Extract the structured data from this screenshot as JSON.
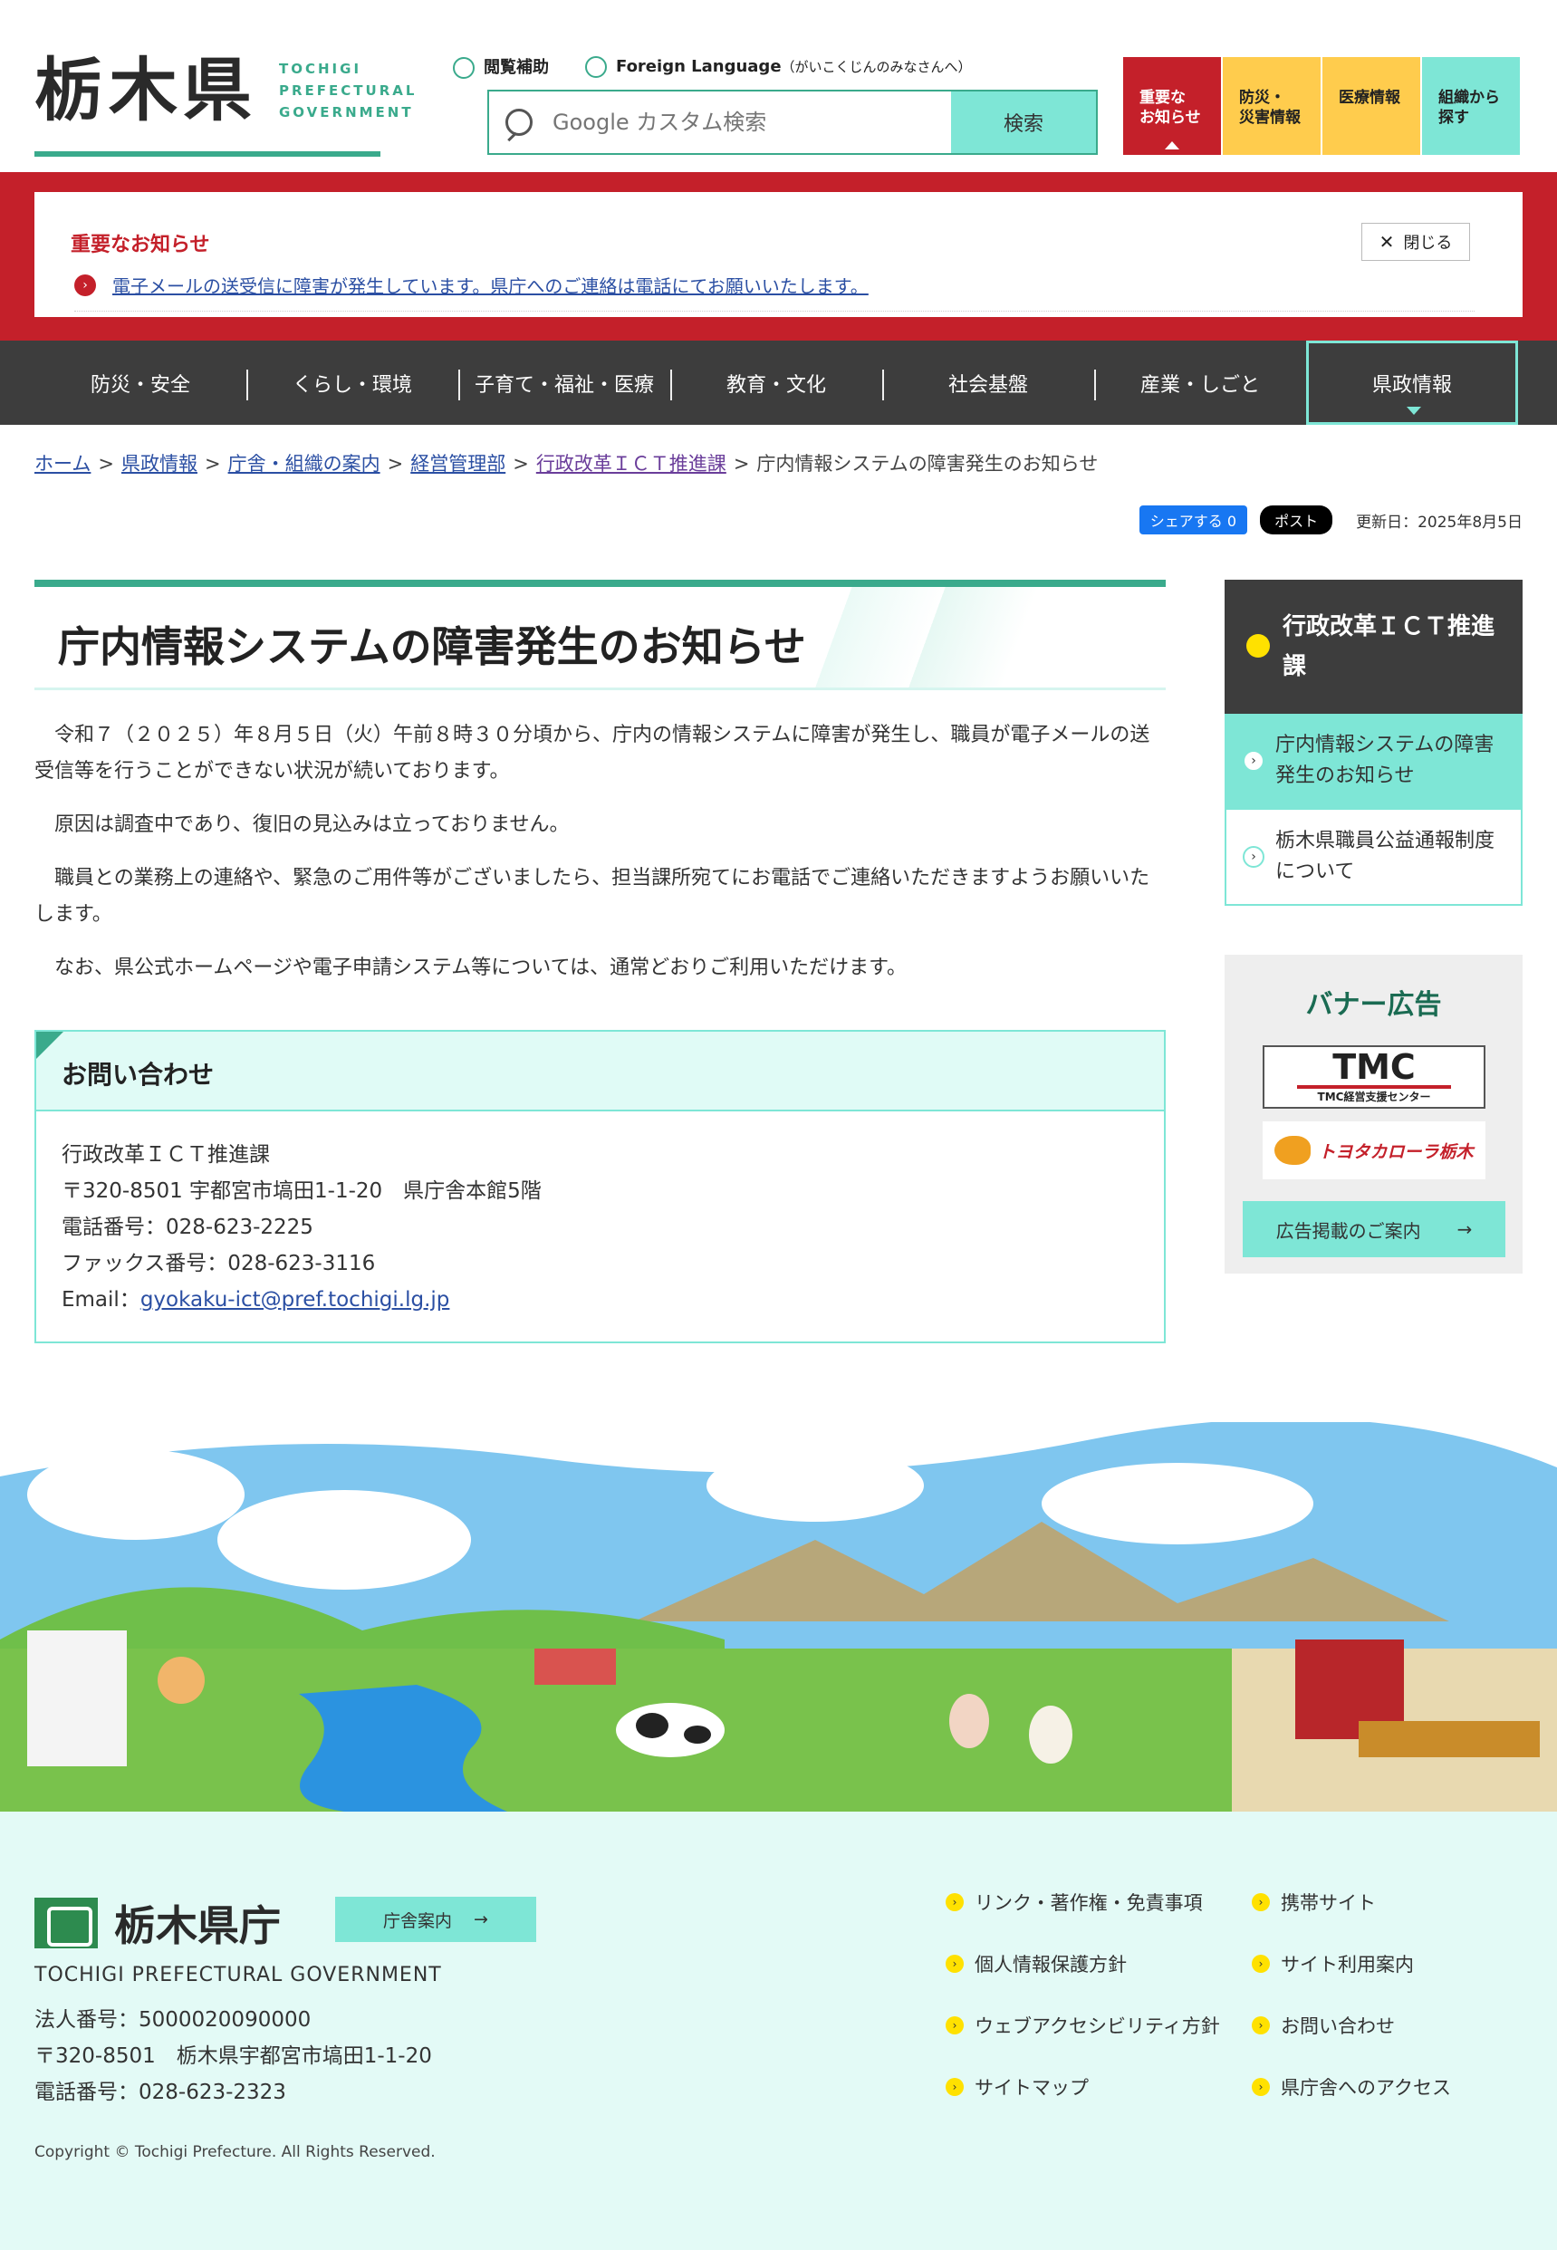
{
  "header": {
    "logo_kanji": "栃木県",
    "logo_en_1": "TOCHIGI",
    "logo_en_2": "PREFECTURAL",
    "logo_en_3": "GOVERNMENT",
    "browse_assist": "閲覧補助",
    "foreign_language": "Foreign Language",
    "foreign_language_sub": "（がいこくじんのみなさんへ）",
    "search_placeholder": "Google カスタム検索",
    "search_button": "検索",
    "quick": [
      {
        "label": "重要な\nお知らせ"
      },
      {
        "label": "防災・\n災害情報"
      },
      {
        "label": "医療情報"
      },
      {
        "label": "組織から\n探す"
      }
    ]
  },
  "notice": {
    "title": "重要なお知らせ",
    "close": "閉じる",
    "message": "電子メールの送受信に障害が発生しています。県庁へのご連絡は電話にてお願いいたします。"
  },
  "nav": [
    "防災・安全",
    "くらし・環境",
    "子育て・福祉・医療",
    "教育・文化",
    "社会基盤",
    "産業・しごと",
    "県政情報"
  ],
  "breadcrumb": [
    "ホーム",
    "県政情報",
    "庁舎・組織の案内",
    "経営管理部",
    "行政改革ＩＣＴ推進課"
  ],
  "breadcrumb_current": "庁内情報システムの障害発生のお知らせ",
  "share": {
    "facebook": "シェアする 0",
    "x": "ポスト",
    "updated": "更新日：2025年8月5日"
  },
  "main": {
    "title": "庁内情報システムの障害発生のお知らせ",
    "paragraphs": [
      "令和７（２０２５）年８月５日（火）午前８時３０分頃から、庁内の情報システムに障害が発生し、職員が電子メールの送受信等を行うことができない状況が続いております。",
      "原因は調査中であり、復旧の見込みは立っておりません。",
      "職員との業務上の連絡や、緊急のご用件等がございましたら、担当課所宛てにお電話でご連絡いただきますようお願いいたします。",
      "なお、県公式ホームページや電子申請システム等については、通常どおりご利用いただけます。"
    ],
    "contact": {
      "heading": "お問い合わせ",
      "dept": "行政改革ＩＣＴ推進課",
      "address": "〒320-8501 宇都宮市塙田1-1-20　県庁舎本館5階",
      "phone": "電話番号：028-623-2225",
      "fax": "ファックス番号：028-623-3116",
      "email_label": "Email：",
      "email": "gyokaku-ict@pref.tochigi.lg.jp"
    }
  },
  "sidebar": {
    "heading": "行政改革ＩＣＴ推進課",
    "links": [
      "庁内情報システムの障害発生のお知らせ",
      "栃木県職員公益通報制度について"
    ],
    "banner_title": "バナー広告",
    "tmc_big": "TMC",
    "tmc_small": "TMC経営支援センター",
    "toyota": "トヨタカローラ栃木",
    "ad_info": "広告掲載のご案内"
  },
  "footer": {
    "name": "栃木県庁",
    "guide": "庁舎案内",
    "en": "TOCHIGI PREFECTURAL GOVERNMENT",
    "corp_no": "法人番号：5000020090000",
    "address": "〒320-8501　栃木県宇都宮市塙田1-1-20",
    "phone": "電話番号：028-623-2323",
    "copyright": "Copyright © Tochigi Prefecture. All Rights Reserved.",
    "links": [
      "リンク・著作権・免責事項",
      "携帯サイト",
      "個人情報保護方針",
      "サイト利用案内",
      "ウェブアクセシビリティ方針",
      "お問い合わせ",
      "サイトマップ",
      "県庁舎へのアクセス"
    ]
  },
  "colors": {
    "accent": "#3aaa8c",
    "mint": "#7ee6d6",
    "alert_red": "#c4202a",
    "nav_bg": "#3d3d3d",
    "yellow": "#ffcc4d"
  }
}
